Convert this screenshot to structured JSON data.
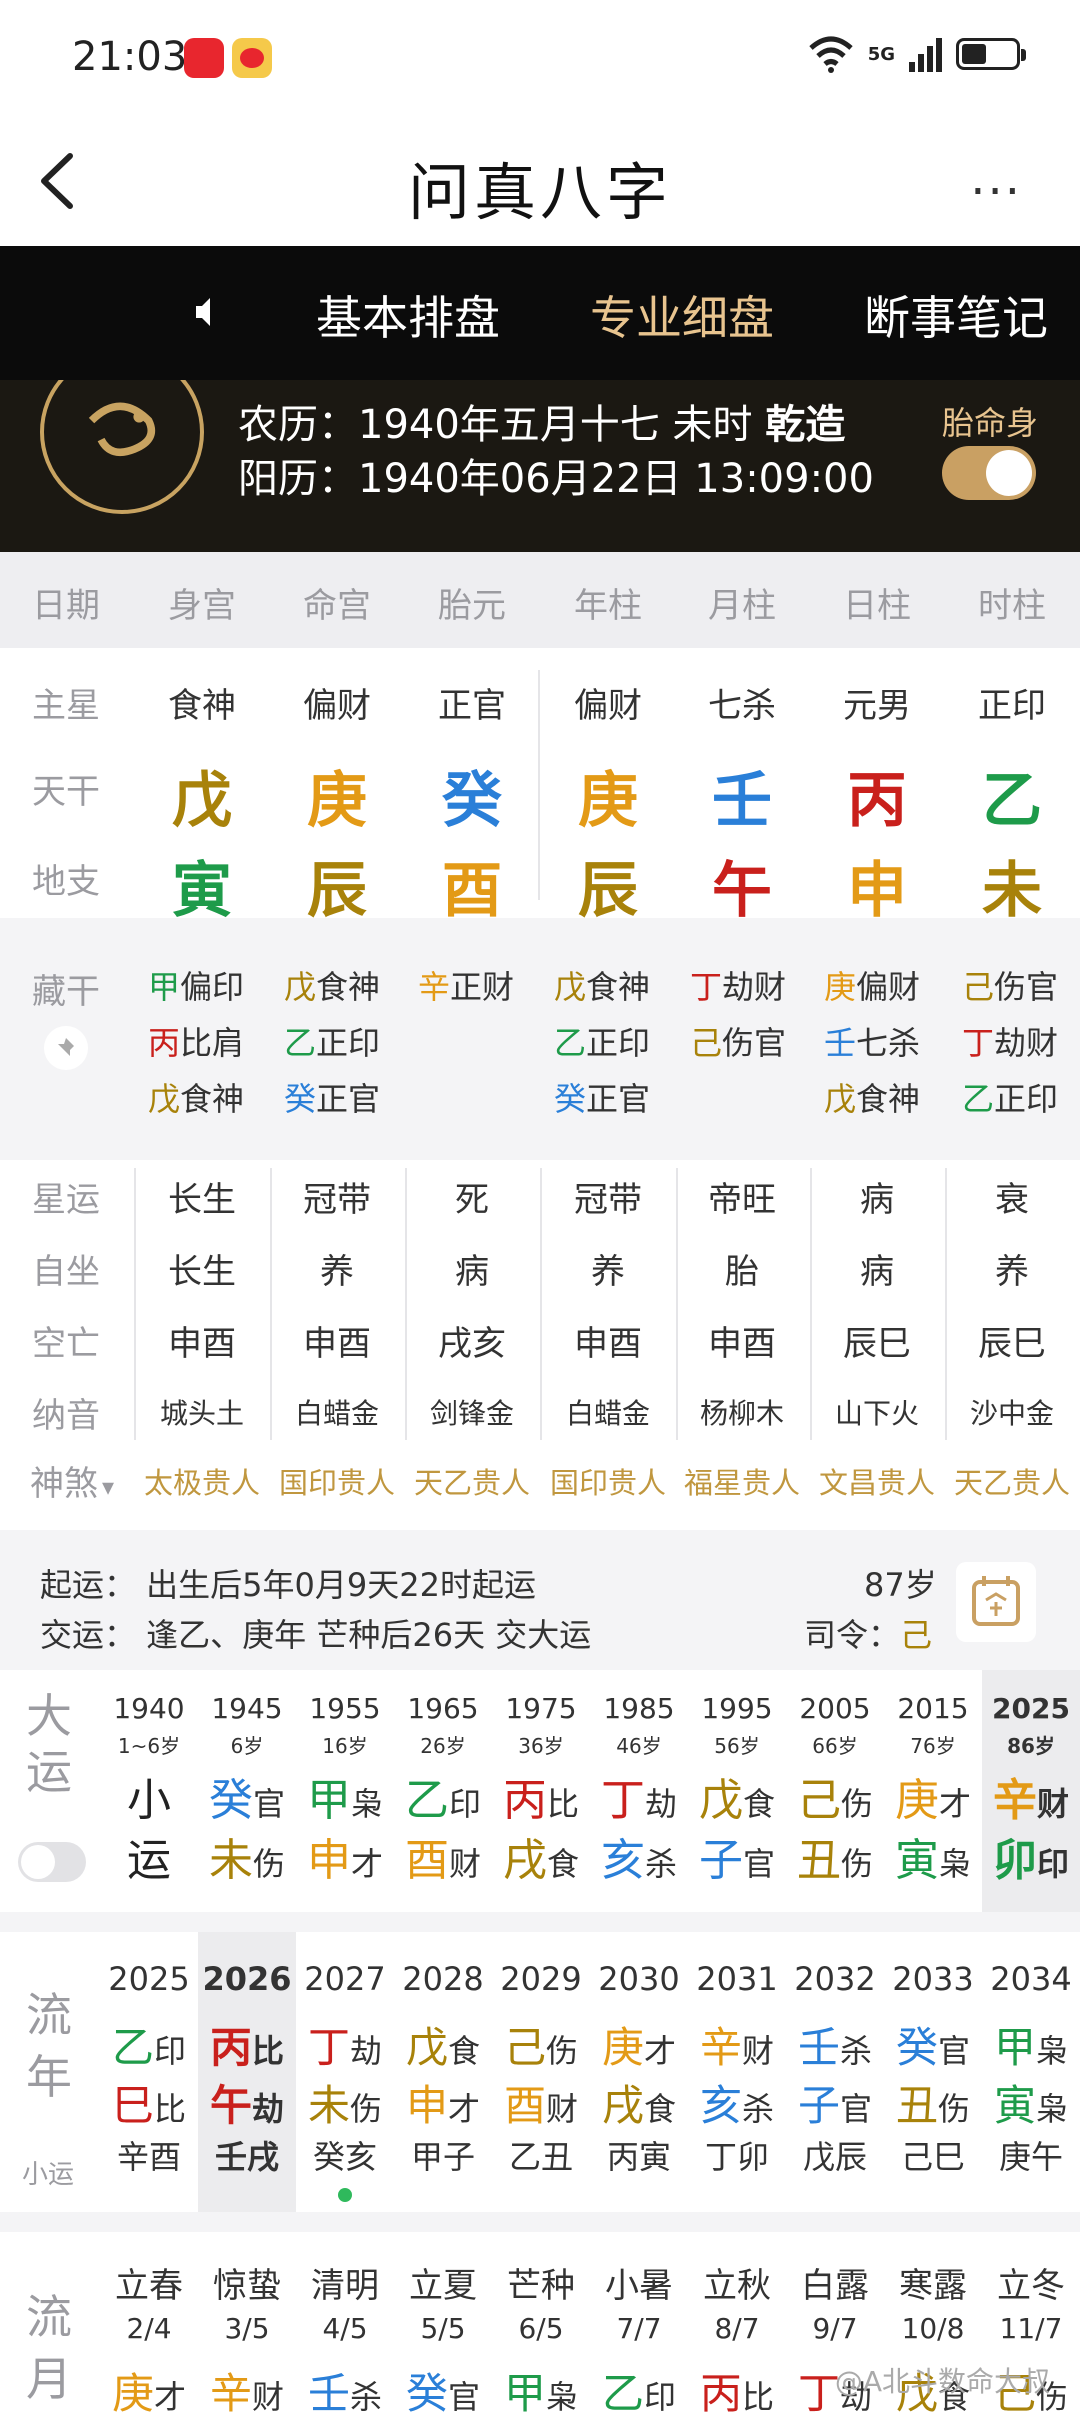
{
  "status": {
    "time": "21:03",
    "network": "5G"
  },
  "nav": {
    "title": "问真八字",
    "more": "···"
  },
  "tabs": [
    "基本排盘",
    "专业细盘",
    "断事笔记"
  ],
  "birth": {
    "lunar_prefix": "农历：1940年五月十七 未时 ",
    "lunar_gender": "乾造",
    "solar": "阳历：1940年06月22日 13:09:00",
    "tml_label": "胎命身"
  },
  "columns": [
    "日期",
    "身宫",
    "命宫",
    "胎元",
    "年柱",
    "月柱",
    "日柱",
    "时柱"
  ],
  "rows": {
    "zhuxing": {
      "label": "主星",
      "values": [
        "食神",
        "偏财",
        "正官",
        "偏财",
        "七杀",
        "元男",
        "正印"
      ]
    },
    "tiangan": {
      "label": "天干",
      "values": [
        [
          "戊",
          "brown"
        ],
        [
          "庚",
          "orange"
        ],
        [
          "癸",
          "blue"
        ],
        [
          "庚",
          "orange"
        ],
        [
          "壬",
          "blue"
        ],
        [
          "丙",
          "red"
        ],
        [
          "乙",
          "green"
        ]
      ]
    },
    "dizhi": {
      "label": "地支",
      "values": [
        [
          "寅",
          "green"
        ],
        [
          "辰",
          "brown"
        ],
        [
          "酉",
          "orange"
        ],
        [
          "辰",
          "brown"
        ],
        [
          "午",
          "red"
        ],
        [
          "申",
          "orange"
        ],
        [
          "未",
          "brown"
        ]
      ]
    }
  },
  "canggan": {
    "label": "藏干",
    "cols": [
      [
        [
          "甲",
          "green",
          "偏印"
        ],
        [
          "丙",
          "red",
          "比肩"
        ],
        [
          "戊",
          "brown",
          "食神"
        ]
      ],
      [
        [
          "戊",
          "brown",
          "食神"
        ],
        [
          "乙",
          "green",
          "正印"
        ],
        [
          "癸",
          "blue",
          "正官"
        ]
      ],
      [
        [
          "辛",
          "orange",
          "正财"
        ]
      ],
      [
        [
          "戊",
          "brown",
          "食神"
        ],
        [
          "乙",
          "green",
          "正印"
        ],
        [
          "癸",
          "blue",
          "正官"
        ]
      ],
      [
        [
          "丁",
          "red",
          "劫财"
        ],
        [
          "己",
          "brown",
          "伤官"
        ]
      ],
      [
        [
          "庚",
          "orange",
          "偏财"
        ],
        [
          "壬",
          "blue",
          "七杀"
        ],
        [
          "戊",
          "brown",
          "食神"
        ]
      ],
      [
        [
          "己",
          "brown",
          "伤官"
        ],
        [
          "丁",
          "red",
          "劫财"
        ],
        [
          "乙",
          "green",
          "正印"
        ]
      ]
    ]
  },
  "states": [
    {
      "label": "星运",
      "values": [
        "长生",
        "冠带",
        "死",
        "冠带",
        "帝旺",
        "病",
        "衰"
      ]
    },
    {
      "label": "自坐",
      "values": [
        "长生",
        "养",
        "病",
        "养",
        "胎",
        "病",
        "养"
      ]
    },
    {
      "label": "空亡",
      "values": [
        "申酉",
        "申酉",
        "戌亥",
        "申酉",
        "申酉",
        "辰巳",
        "辰巳"
      ]
    },
    {
      "label": "纳音",
      "values": [
        "城头土",
        "白蜡金",
        "剑锋金",
        "白蜡金",
        "杨柳木",
        "山下火",
        "沙中金"
      ]
    }
  ],
  "shensha": {
    "label": "神煞",
    "values": [
      "太极贵人",
      "国印贵人",
      "天乙贵人",
      "国印贵人",
      "福星贵人",
      "文昌贵人",
      "天乙贵人"
    ]
  },
  "qiyun": {
    "line1": "起运：  出生后5年0月9天22时起运",
    "age": "87岁",
    "line2": "交运：  逢乙、庚年 芒种后26天 交大运",
    "siling_label": "司令：",
    "siling_value": "己"
  },
  "dayun": {
    "label": "大运",
    "cols": [
      {
        "year": "1940",
        "age": "1~6岁",
        "g": [
          "小",
          ""
        ],
        "z": [
          "运",
          ""
        ]
      },
      {
        "year": "1945",
        "age": "6岁",
        "g": [
          "癸",
          "blue",
          "官"
        ],
        "z": [
          "未",
          "brown",
          "伤"
        ]
      },
      {
        "year": "1955",
        "age": "16岁",
        "g": [
          "甲",
          "green",
          "枭"
        ],
        "z": [
          "申",
          "orange",
          "才"
        ]
      },
      {
        "year": "1965",
        "age": "26岁",
        "g": [
          "乙",
          "green",
          "印"
        ],
        "z": [
          "酉",
          "orange",
          "财"
        ]
      },
      {
        "year": "1975",
        "age": "36岁",
        "g": [
          "丙",
          "red",
          "比"
        ],
        "z": [
          "戌",
          "brown",
          "食"
        ]
      },
      {
        "year": "1985",
        "age": "46岁",
        "g": [
          "丁",
          "red",
          "劫"
        ],
        "z": [
          "亥",
          "blue",
          "杀"
        ]
      },
      {
        "year": "1995",
        "age": "56岁",
        "g": [
          "戊",
          "brown",
          "食"
        ],
        "z": [
          "子",
          "blue",
          "官"
        ]
      },
      {
        "year": "2005",
        "age": "66岁",
        "g": [
          "己",
          "brown",
          "伤"
        ],
        "z": [
          "丑",
          "brown",
          "伤"
        ]
      },
      {
        "year": "2015",
        "age": "76岁",
        "g": [
          "庚",
          "orange",
          "才"
        ],
        "z": [
          "寅",
          "green",
          "枭"
        ]
      },
      {
        "year": "2025",
        "age": "86岁",
        "g": [
          "辛",
          "orange",
          "财"
        ],
        "z": [
          "卯",
          "green",
          "印"
        ]
      }
    ]
  },
  "liunian": {
    "label": "流年",
    "sub": "小运",
    "cols": [
      {
        "year": "2025",
        "g": [
          "乙",
          "green",
          "印"
        ],
        "z": [
          "巳",
          "red",
          "比"
        ],
        "x": "辛酉"
      },
      {
        "year": "2026",
        "g": [
          "丙",
          "red",
          "比"
        ],
        "z": [
          "午",
          "red",
          "劫"
        ],
        "x": "壬戌"
      },
      {
        "year": "2027",
        "g": [
          "丁",
          "red",
          "劫"
        ],
        "z": [
          "未",
          "brown",
          "伤"
        ],
        "x": "癸亥"
      },
      {
        "year": "2028",
        "g": [
          "戊",
          "brown",
          "食"
        ],
        "z": [
          "申",
          "orange",
          "才"
        ],
        "x": "甲子"
      },
      {
        "year": "2029",
        "g": [
          "己",
          "brown",
          "伤"
        ],
        "z": [
          "酉",
          "orange",
          "财"
        ],
        "x": "乙丑"
      },
      {
        "year": "2030",
        "g": [
          "庚",
          "orange",
          "才"
        ],
        "z": [
          "戌",
          "brown",
          "食"
        ],
        "x": "丙寅"
      },
      {
        "year": "2031",
        "g": [
          "辛",
          "orange",
          "财"
        ],
        "z": [
          "亥",
          "blue",
          "杀"
        ],
        "x": "丁卯"
      },
      {
        "year": "2032",
        "g": [
          "壬",
          "blue",
          "杀"
        ],
        "z": [
          "子",
          "blue",
          "官"
        ],
        "x": "戊辰"
      },
      {
        "year": "2033",
        "g": [
          "癸",
          "blue",
          "官"
        ],
        "z": [
          "丑",
          "brown",
          "伤"
        ],
        "x": "己巳"
      },
      {
        "year": "2034",
        "g": [
          "甲",
          "green",
          "枭"
        ],
        "z": [
          "寅",
          "green",
          "枭"
        ],
        "x": "庚午"
      }
    ]
  },
  "liuyue": {
    "label": "流月",
    "cols": [
      {
        "term": "立春",
        "date": "2/4",
        "g": [
          "庚",
          "orange",
          "才"
        ]
      },
      {
        "term": "惊蛰",
        "date": "3/5",
        "g": [
          "辛",
          "orange",
          "财"
        ]
      },
      {
        "term": "清明",
        "date": "4/5",
        "g": [
          "壬",
          "blue",
          "杀"
        ]
      },
      {
        "term": "立夏",
        "date": "5/5",
        "g": [
          "癸",
          "blue",
          "官"
        ]
      },
      {
        "term": "芒种",
        "date": "6/5",
        "g": [
          "甲",
          "green",
          "枭"
        ]
      },
      {
        "term": "小暑",
        "date": "7/7",
        "g": [
          "乙",
          "green",
          "印"
        ]
      },
      {
        "term": "立秋",
        "date": "8/7",
        "g": [
          "丙",
          "red",
          "比"
        ]
      },
      {
        "term": "白露",
        "date": "9/7",
        "g": [
          "丁",
          "red",
          "劫"
        ]
      },
      {
        "term": "寒露",
        "date": "10/8",
        "g": [
          "戊",
          "brown",
          "食"
        ]
      },
      {
        "term": "立冬",
        "date": "11/7",
        "g": [
          "己",
          "brown",
          "伤"
        ]
      }
    ]
  },
  "watermark": "@A北斗数命大叔"
}
